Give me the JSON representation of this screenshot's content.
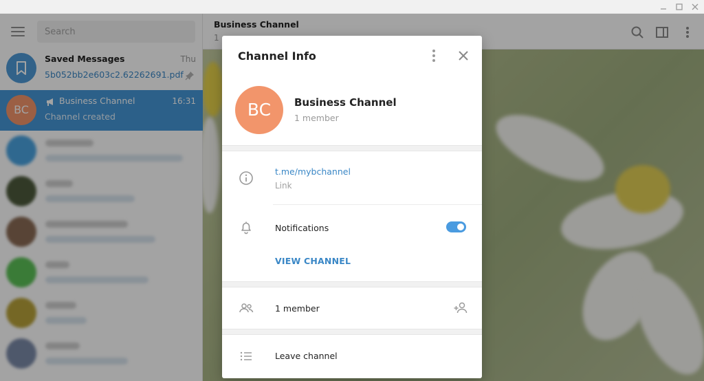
{
  "search": {
    "placeholder": "Search"
  },
  "chats": [
    {
      "name": "Saved Messages",
      "time": "Thu",
      "message": "5b052bb2e603c2.62262691.pdf"
    },
    {
      "name": "Business Channel",
      "time": "16:31",
      "message": "Channel created",
      "initials": "BC"
    }
  ],
  "main_header": {
    "title": "Business Channel",
    "subtitle": "1"
  },
  "dialog": {
    "title": "Channel Info",
    "channel_name": "Business Channel",
    "initials": "BC",
    "member_count": "1 member",
    "link_value": "t.me/mybchannel",
    "link_label": "Link",
    "notifications_label": "Notifications",
    "notifications_on": true,
    "view_channel_label": "VIEW CHANNEL",
    "members_label": "1 member",
    "leave_label": "Leave channel"
  },
  "colors": {
    "accent": "#4596d6",
    "avatar_bc": "#f2956b",
    "link": "#3a87c6",
    "toggle": "#4a9be0"
  },
  "icons": {
    "menu": "menu-icon",
    "bookmark": "bookmark-icon",
    "megaphone": "megaphone-icon",
    "pin": "pin-icon",
    "search": "search-icon",
    "columns": "columns-icon",
    "more": "more-vertical-icon",
    "close": "close-icon",
    "info": "info-icon",
    "bell": "bell-icon",
    "users": "users-icon",
    "add_user": "add-user-icon",
    "list": "list-icon"
  }
}
